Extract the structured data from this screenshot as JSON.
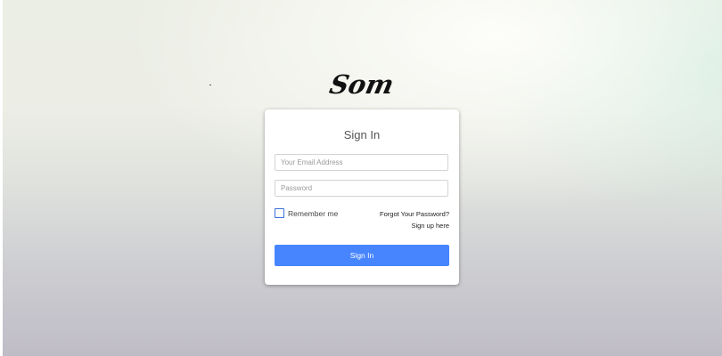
{
  "brand": {
    "logo_text": "Som",
    "logo_color": "#111111"
  },
  "login_card": {
    "title": "Sign In",
    "email_placeholder": "Your Email Address",
    "email_value": "",
    "password_placeholder": "Password",
    "password_value": "",
    "remember_label": "Remember me",
    "remember_checked": false,
    "forgot_password_label": "Forgot Your Password?",
    "signup_label": "Sign up here",
    "submit_label": "Sign In",
    "submit_color": "#4785ff",
    "checkbox_color": "#3a6fd8"
  }
}
